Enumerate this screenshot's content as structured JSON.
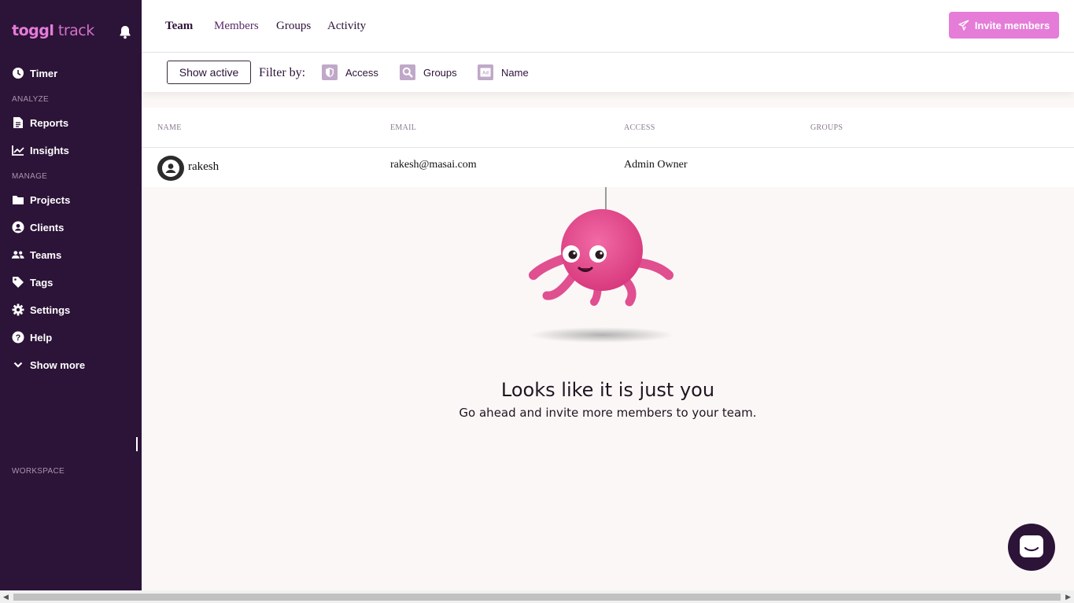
{
  "sidebar": {
    "logo_bold": "toggl",
    "logo_light": "track",
    "timer": "Timer",
    "analyze_label": "ANALYZE",
    "reports": "Reports",
    "insights": "Insights",
    "manage_label": "MANAGE",
    "projects": "Projects",
    "clients": "Clients",
    "teams": "Teams",
    "tags": "Tags",
    "settings": "Settings",
    "help": "Help",
    "show_more": "Show more",
    "workspace_label": "WORKSPACE"
  },
  "header": {
    "tabs": [
      "Team",
      "Members",
      "Groups",
      "Activity"
    ],
    "invite_label": "Invite members"
  },
  "filters": {
    "show_active": "Show active",
    "filter_by": "Filter by:",
    "chips": [
      "Access",
      "Groups",
      "Name"
    ]
  },
  "table": {
    "columns": [
      "NAME",
      "EMAIL",
      "ACCESS",
      "GROUPS"
    ],
    "rows": [
      {
        "name": "rakesh",
        "email": "rakesh@masai.com",
        "access": "Admin Owner",
        "groups": ""
      }
    ]
  },
  "empty_state": {
    "title": "Looks like it is just you",
    "subtitle": "Go ahead and invite more members to your team."
  },
  "colors": {
    "sidebar_bg": "#2c1338",
    "accent_pink": "#e57cd8",
    "page_bg": "#fcf7f7"
  },
  "icons": {
    "bell": "bell-icon",
    "timer": "clock-icon",
    "reports": "document-icon",
    "insights": "chart-icon",
    "projects": "folder-icon",
    "clients": "person-circle-icon",
    "teams": "people-icon",
    "tags": "tag-icon",
    "settings": "gear-icon",
    "help": "question-icon",
    "show_more": "chevron-down-icon",
    "invite": "paper-plane-icon",
    "chat": "chat-icon"
  }
}
